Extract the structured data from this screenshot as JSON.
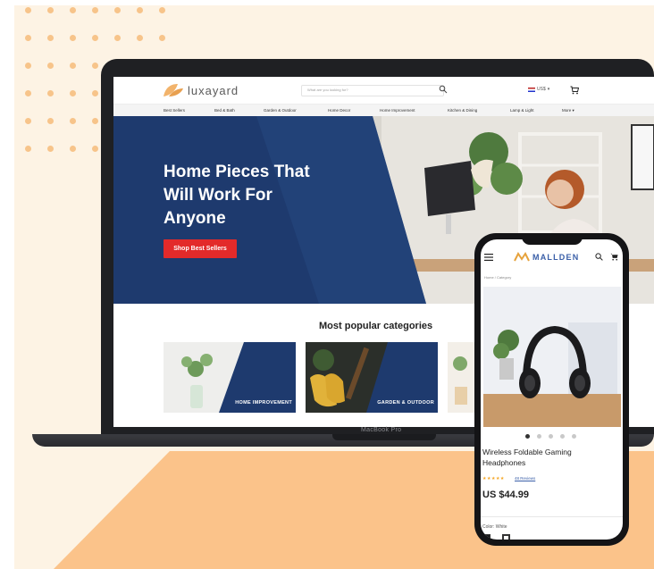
{
  "site": {
    "brand": "luxayard",
    "search_placeholder": "What are you looking for?",
    "currency": "US$",
    "nav": [
      "Best Sellers",
      "Bed & Bath",
      "Garden & Outdoor",
      "Home Decor",
      "Home Improvement",
      "Kitchen & Dining",
      "Lamp & Light",
      "More"
    ]
  },
  "hero": {
    "title": "Home Pieces That\nWill Work For\nAnyone",
    "button": "Shop Best Sellers"
  },
  "categories": {
    "heading": "Most popular categories",
    "items": [
      "HOME IMPROVEMENT",
      "GARDEN & OUTDOOR"
    ]
  },
  "laptop": {
    "model": "MacBook Pro"
  },
  "mobile": {
    "brand": "MALLDEN",
    "breadcrumb": "Home  /  Category",
    "product_title": "Wireless Foldable Gaming\nHeadphones",
    "stars": "★★★★★",
    "rating": 5,
    "reviews": "48 Reviews",
    "price": "US $44.99",
    "color_label": "Color: White",
    "carousel_count": 5,
    "carousel_active": 0
  },
  "colors": {
    "hero_blue": "#1e3a6e",
    "cta_red": "#e32a2a",
    "accent_orange": "#fbc38a",
    "mobile_brand": "#3a5fa8"
  }
}
